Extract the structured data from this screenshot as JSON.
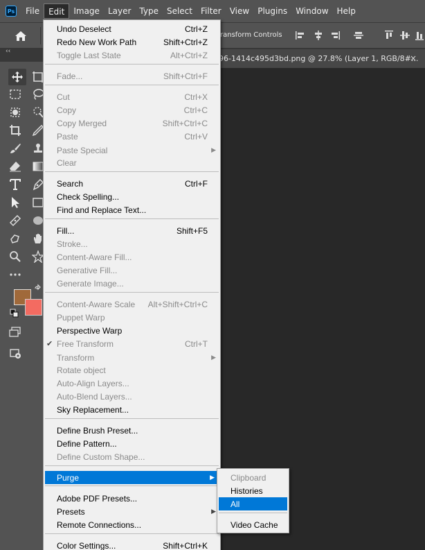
{
  "app": {
    "logo": "Ps"
  },
  "menubar": [
    "File",
    "Edit",
    "Image",
    "Layer",
    "Type",
    "Select",
    "Filter",
    "View",
    "Plugins",
    "Window",
    "Help"
  ],
  "options_bar": {
    "transform_controls_label": "ransform Controls"
  },
  "tabrow": {
    "collapse": "‹‹"
  },
  "document_tab": {
    "title": "96-1414c495d3bd.png @ 27.8% (Layer 1, RGB/8#...",
    "close": "×"
  },
  "colors": {
    "foreground": "#a0693a",
    "background": "#f36b61",
    "menu_highlight": "#0078d7"
  },
  "edit_menu": [
    {
      "label": "Undo Deselect",
      "shortcut": "Ctrl+Z"
    },
    {
      "label": "Redo New Work Path",
      "shortcut": "Shift+Ctrl+Z"
    },
    {
      "label": "Toggle Last State",
      "shortcut": "Alt+Ctrl+Z",
      "disabled": true
    },
    {
      "label": "Fade...",
      "shortcut": "Shift+Ctrl+F",
      "disabled": true
    },
    {
      "label": "Cut",
      "shortcut": "Ctrl+X",
      "disabled": true
    },
    {
      "label": "Copy",
      "shortcut": "Ctrl+C",
      "disabled": true
    },
    {
      "label": "Copy Merged",
      "shortcut": "Shift+Ctrl+C",
      "disabled": true
    },
    {
      "label": "Paste",
      "shortcut": "Ctrl+V",
      "disabled": true
    },
    {
      "label": "Paste Special",
      "shortcut": "",
      "disabled": true,
      "submenu": true
    },
    {
      "label": "Clear",
      "shortcut": "",
      "disabled": true
    },
    {
      "label": "Search",
      "shortcut": "Ctrl+F"
    },
    {
      "label": "Check Spelling...",
      "shortcut": ""
    },
    {
      "label": "Find and Replace Text...",
      "shortcut": ""
    },
    {
      "label": "Fill...",
      "shortcut": "Shift+F5"
    },
    {
      "label": "Stroke...",
      "shortcut": "",
      "disabled": true
    },
    {
      "label": "Content-Aware Fill...",
      "shortcut": "",
      "disabled": true
    },
    {
      "label": "Generative Fill...",
      "shortcut": "",
      "disabled": true
    },
    {
      "label": "Generate Image...",
      "shortcut": "",
      "disabled": true
    },
    {
      "label": "Content-Aware Scale",
      "shortcut": "Alt+Shift+Ctrl+C",
      "disabled": true
    },
    {
      "label": "Puppet Warp",
      "shortcut": "",
      "disabled": true
    },
    {
      "label": "Perspective Warp",
      "shortcut": ""
    },
    {
      "label": "Free Transform",
      "shortcut": "Ctrl+T",
      "disabled": true,
      "checked": true
    },
    {
      "label": "Transform",
      "shortcut": "",
      "disabled": true,
      "submenu": true
    },
    {
      "label": "Rotate object",
      "shortcut": "",
      "disabled": true
    },
    {
      "label": "Auto-Align Layers...",
      "shortcut": "",
      "disabled": true
    },
    {
      "label": "Auto-Blend Layers...",
      "shortcut": "",
      "disabled": true
    },
    {
      "label": "Sky Replacement...",
      "shortcut": ""
    },
    {
      "label": "Define Brush Preset...",
      "shortcut": ""
    },
    {
      "label": "Define Pattern...",
      "shortcut": ""
    },
    {
      "label": "Define Custom Shape...",
      "shortcut": "",
      "disabled": true
    },
    {
      "label": "Purge",
      "shortcut": "",
      "submenu": true,
      "selected": true
    },
    {
      "label": "Adobe PDF Presets...",
      "shortcut": ""
    },
    {
      "label": "Presets",
      "shortcut": "",
      "submenu": true
    },
    {
      "label": "Remote Connections...",
      "shortcut": ""
    },
    {
      "label": "Color Settings...",
      "shortcut": "Shift+Ctrl+K"
    }
  ],
  "purge_submenu": [
    {
      "label": "Clipboard",
      "disabled": true
    },
    {
      "label": "Histories"
    },
    {
      "label": "All",
      "selected": true
    },
    {
      "label": "Video Cache"
    }
  ]
}
